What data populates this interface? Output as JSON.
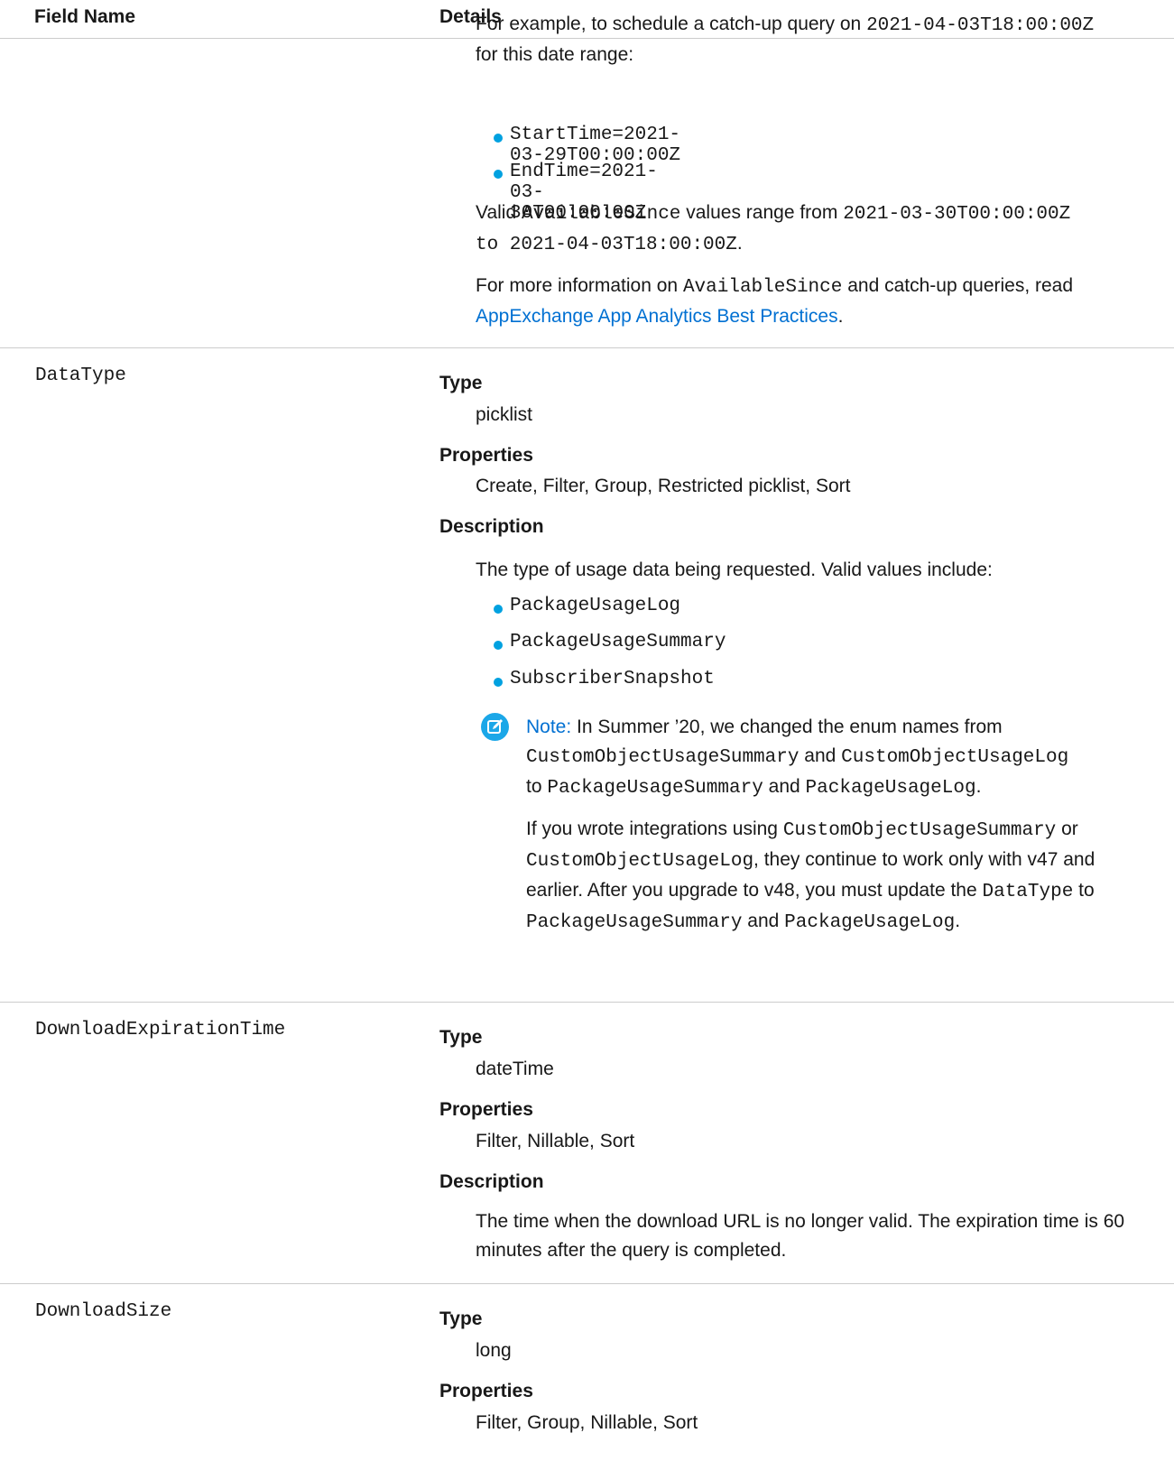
{
  "header": {
    "field_name": "Field Name",
    "details": "Details"
  },
  "row_available_since": {
    "example_intro_pre": "For example, to schedule a catch-up query on ",
    "example_date": "2021-04-03T18:00:00Z",
    "example_intro_post": "for this date range:",
    "bullets": [
      "StartTime=2021-03-29T00:00:00Z",
      "EndTime=2021-03-30T00:00:00Z"
    ],
    "valid_pre": "Valid ",
    "valid_code": "AvailableSince",
    "valid_mid": " values range from ",
    "valid_from": "2021-03-30T00:00:00Z",
    "valid_to_code": "to 2021-04-03T18:00:00Z",
    "valid_end": ".",
    "more_pre": "For more information on ",
    "more_code": "AvailableSince",
    "more_post": " and catch-up queries, read",
    "link_text": "AppExchange App Analytics Best Practices",
    "link_end": "."
  },
  "row_data_type": {
    "field": "DataType",
    "type_label": "Type",
    "type_value": "picklist",
    "props_label": "Properties",
    "props_value": "Create, Filter, Group, Restricted picklist, Sort",
    "desc_label": "Description",
    "desc_text": "The type of usage data being requested. Valid values include:",
    "values": [
      "PackageUsageLog",
      "PackageUsageSummary",
      "SubscriberSnapshot"
    ],
    "note_label": "Note:",
    "note_line1": "In Summer ’20, we changed the enum names from",
    "note_code1": "CustomObjectUsageSummary",
    "note_and1": " and ",
    "note_code2": "CustomObjectUsageLog",
    "note_to": "to ",
    "note_code3": "PackageUsageSummary",
    "note_and2": " and ",
    "note_code4": "PackageUsageLog",
    "note_end": ".",
    "note2_pre": "If you wrote integrations using ",
    "note2_code1": "CustomObjectUsageSummary",
    "note2_or": " or",
    "note2_code2": "CustomObjectUsageLog",
    "note2_mid": ", they continue to work only with v47 and",
    "note2_line3_pre": "earlier. After you upgrade to v48, you must update the ",
    "note2_code3": "DataType",
    "note2_to": " to",
    "note2_code4": "PackageUsageSummary",
    "note2_and": " and ",
    "note2_code5": "PackageUsageLog",
    "note2_end": "."
  },
  "row_download_expiration": {
    "field": "DownloadExpirationTime",
    "type_label": "Type",
    "type_value": "dateTime",
    "props_label": "Properties",
    "props_value": "Filter, Nillable, Sort",
    "desc_label": "Description",
    "desc_line1": "The time when the download URL is no longer valid. The expiration time is 60",
    "desc_line2": "minutes after the query is completed."
  },
  "row_download_size": {
    "field": "DownloadSize",
    "type_label": "Type",
    "type_value": "long",
    "props_label": "Properties",
    "props_value": "Filter, Group, Nillable, Sort"
  }
}
